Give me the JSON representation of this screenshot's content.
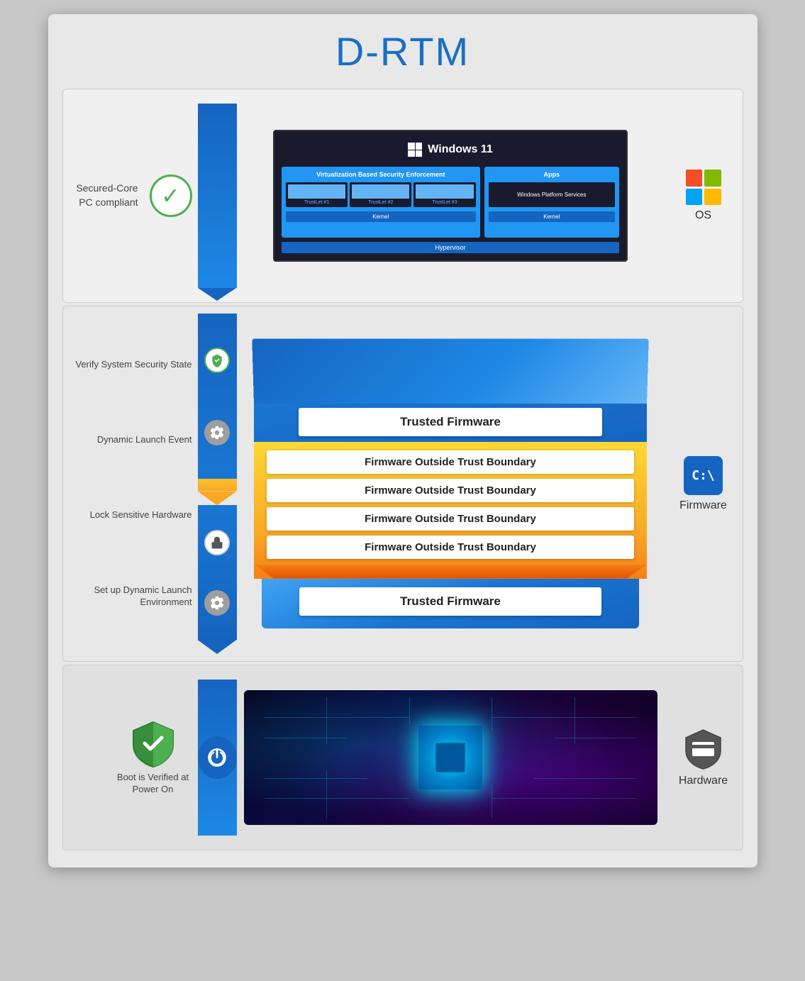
{
  "title": "D-RTM",
  "sections": {
    "os": {
      "label": "Secured-Core\nPC compliant",
      "right_label": "OS",
      "windows_title": "Windows 11",
      "vbs_label": "Virtualization Based\nSecurity Enforcement",
      "apps_label": "Apps",
      "wps_label": "Windows\nPlatform\nServices",
      "kernel_label": "Kernel",
      "hypervisor_label": "Hypervisor"
    },
    "firmware": {
      "right_label": "Firmware",
      "labels": {
        "verify": "Verify System\nSecurity State",
        "dynamic_launch": "Dynamic\nLaunch Event",
        "lock_hw": "Lock Sensitive\nHardware",
        "setup_dle": "Set up Dynamic\nLaunch Environment"
      },
      "trusted_firmware_top": "Trusted Firmware",
      "outside_boundary": "Firmware Outside Trust Boundary",
      "trusted_firmware_bottom": "Trusted Firmware"
    },
    "hardware": {
      "left_label": "Boot is Verified\nat Power On",
      "right_label": "Hardware"
    }
  }
}
